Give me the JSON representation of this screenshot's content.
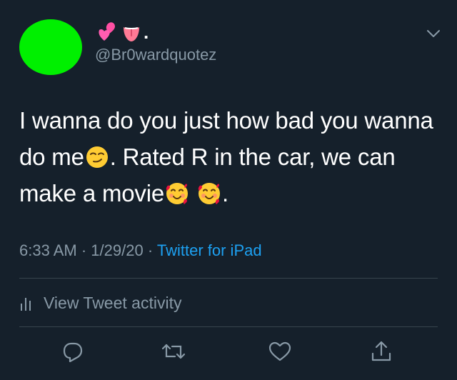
{
  "user": {
    "display_name_emojis": [
      "two-hearts-emoji",
      "tongue-emoji"
    ],
    "display_name_suffix": ".",
    "handle": "@Br0wardquotez",
    "avatar_color": "#00f000"
  },
  "tweet": {
    "segments": [
      {
        "type": "text",
        "value": "I wanna do you just how bad you wanna do me"
      },
      {
        "type": "emoji",
        "name": "smirking-face-emoji"
      },
      {
        "type": "text",
        "value": ". Rated R in the car, we can make a movie"
      },
      {
        "type": "emoji",
        "name": "smiling-face-with-hearts-emoji"
      },
      {
        "type": "text",
        "value": " "
      },
      {
        "type": "emoji",
        "name": "smiling-face-with-hearts-emoji"
      },
      {
        "type": "text",
        "value": "."
      }
    ]
  },
  "meta": {
    "time": "6:33 AM",
    "separator": "·",
    "date": "1/29/20",
    "source": "Twitter for iPad"
  },
  "activity": {
    "label": "View Tweet activity",
    "icon": "bar-chart-icon"
  },
  "actions": [
    {
      "name": "reply-icon"
    },
    {
      "name": "retweet-icon"
    },
    {
      "name": "like-icon"
    },
    {
      "name": "share-icon"
    }
  ],
  "colors": {
    "background": "#15202b",
    "text": "#ffffff",
    "secondary_text": "#8899a6",
    "link": "#1da1f2",
    "divider": "#38444d"
  }
}
